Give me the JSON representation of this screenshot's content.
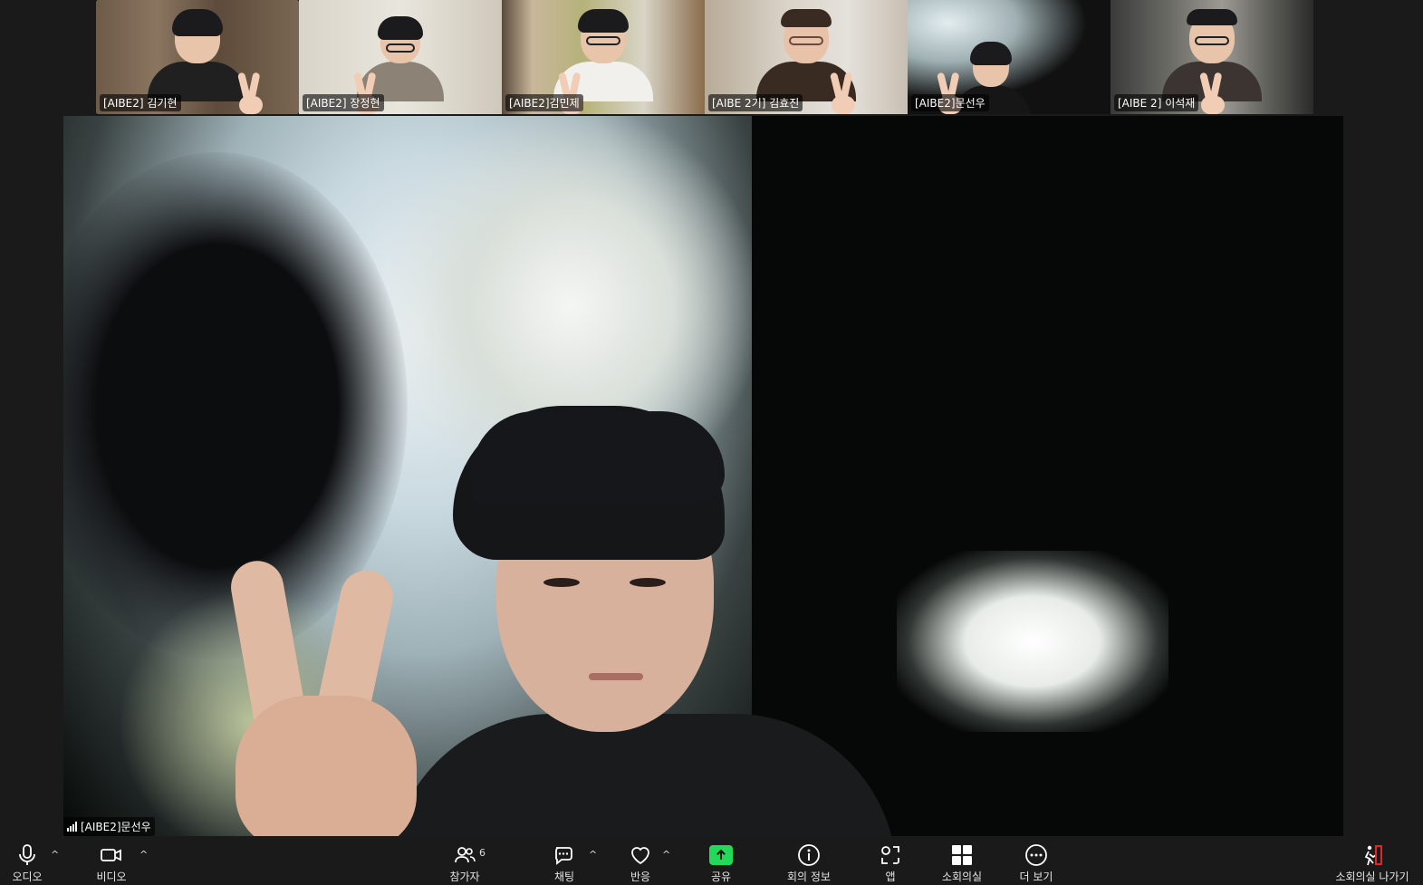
{
  "thumbnails": [
    {
      "name": "[AIBE2] 김기현",
      "active": true
    },
    {
      "name": "[AIBE2] 장정현",
      "active": false
    },
    {
      "name": "[AIBE2]김민제",
      "active": false
    },
    {
      "name": "[AIBE 2기] 김효진",
      "active": false
    },
    {
      "name": "[AIBE2]문선우",
      "active": false
    },
    {
      "name": "[AIBE 2] 이석재",
      "active": false
    }
  ],
  "main_video": {
    "name": "[AIBE2]문선우"
  },
  "toolbar": {
    "audio": "오디오",
    "video": "비디오",
    "participants": "참가자",
    "participants_count": "6",
    "chat": "채팅",
    "reactions": "반응",
    "share": "공유",
    "meeting_info": "회의 정보",
    "apps": "앱",
    "breakout_rooms": "소회의실",
    "more": "더 보기",
    "leave_breakout": "소회의실 나가기"
  },
  "colors": {
    "accent": "#23d959",
    "leave": "#e02828"
  }
}
